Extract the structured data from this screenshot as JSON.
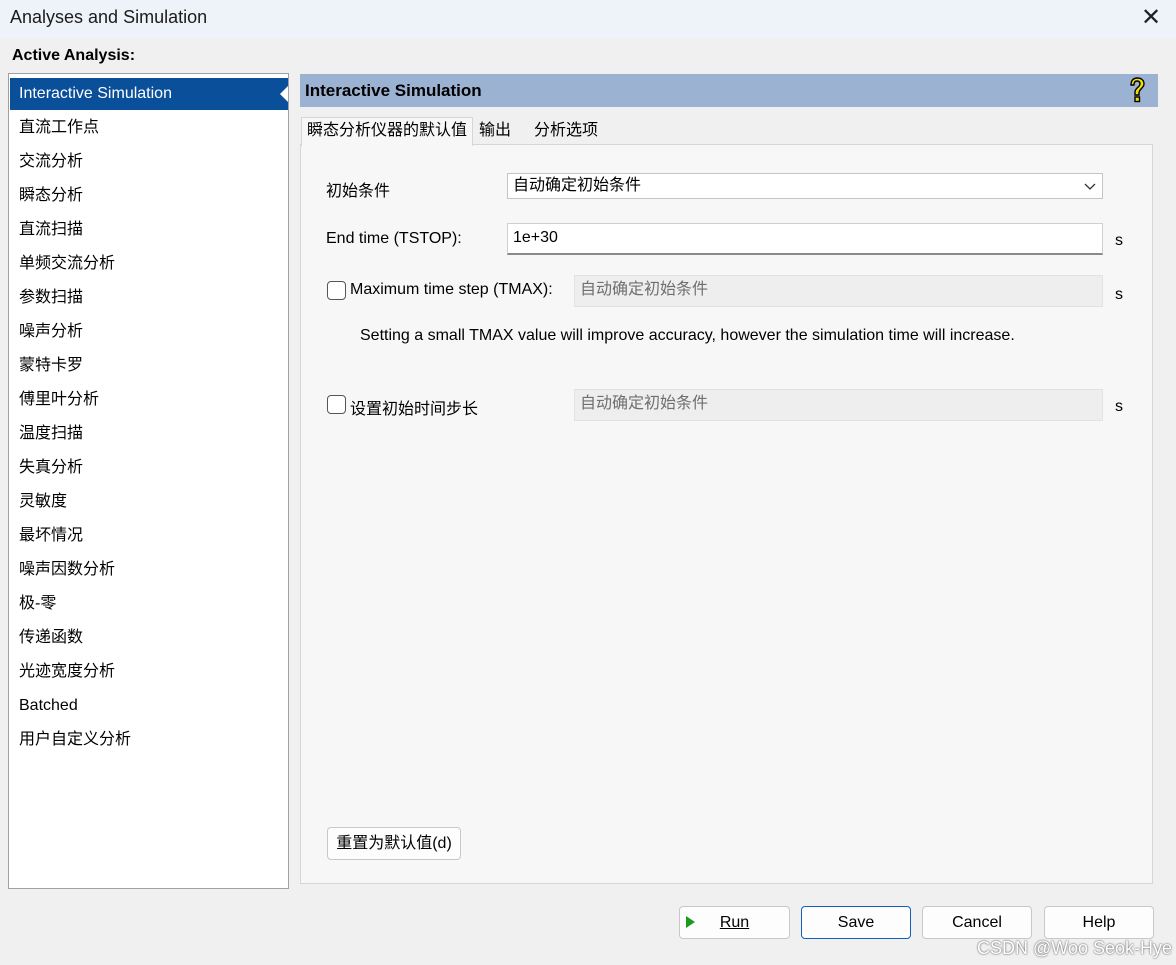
{
  "window": {
    "title": "Analyses and Simulation",
    "close_glyph": "✕"
  },
  "sidebar": {
    "heading": "Active Analysis:",
    "selected_index": 0,
    "items": [
      {
        "label": "Interactive Simulation"
      },
      {
        "label": "直流工作点"
      },
      {
        "label": "交流分析"
      },
      {
        "label": "瞬态分析"
      },
      {
        "label": "直流扫描"
      },
      {
        "label": "单频交流分析"
      },
      {
        "label": "参数扫描"
      },
      {
        "label": "噪声分析"
      },
      {
        "label": "蒙特卡罗"
      },
      {
        "label": "傅里叶分析"
      },
      {
        "label": "温度扫描"
      },
      {
        "label": "失真分析"
      },
      {
        "label": "灵敏度"
      },
      {
        "label": "最坏情况"
      },
      {
        "label": "噪声因数分析"
      },
      {
        "label": "极-零"
      },
      {
        "label": "传递函数"
      },
      {
        "label": "光迹宽度分析"
      },
      {
        "label": "Batched"
      },
      {
        "label": "用户自定义分析"
      }
    ]
  },
  "panel": {
    "title": "Interactive Simulation",
    "help_icon": "question-mark-icon",
    "tabs": [
      {
        "label": "瞬态分析仪器的默认值",
        "active": true
      },
      {
        "label": "输出",
        "active": false
      },
      {
        "label": "分析选项",
        "active": false
      }
    ]
  },
  "form": {
    "initial_conditions": {
      "label": "初始条件",
      "value": "自动确定初始条件"
    },
    "end_time": {
      "label": "End time (TSTOP):",
      "value": "1e+30",
      "unit": "s"
    },
    "max_time_step": {
      "label": "Maximum time step (TMAX):",
      "checked": false,
      "value": "自动确定初始条件",
      "unit": "s"
    },
    "hint": "Setting a small TMAX value will improve accuracy, however the simulation time will increase.",
    "initial_time_step": {
      "label": "设置初始时间步长",
      "checked": false,
      "value": "自动确定初始条件",
      "unit": "s"
    },
    "reset_label": "重置为默认值(d)"
  },
  "footer": {
    "run_label": "Run",
    "save_label": "Save",
    "cancel_label": "Cancel",
    "help_label": "Help"
  },
  "watermark": "CSDN @Woo Seok-Hye",
  "colors": {
    "selection": "#0a4f9a",
    "header_bar": "#9bb2d2",
    "run_icon": "#1b9a1b",
    "help_icon": "#f2e000"
  }
}
